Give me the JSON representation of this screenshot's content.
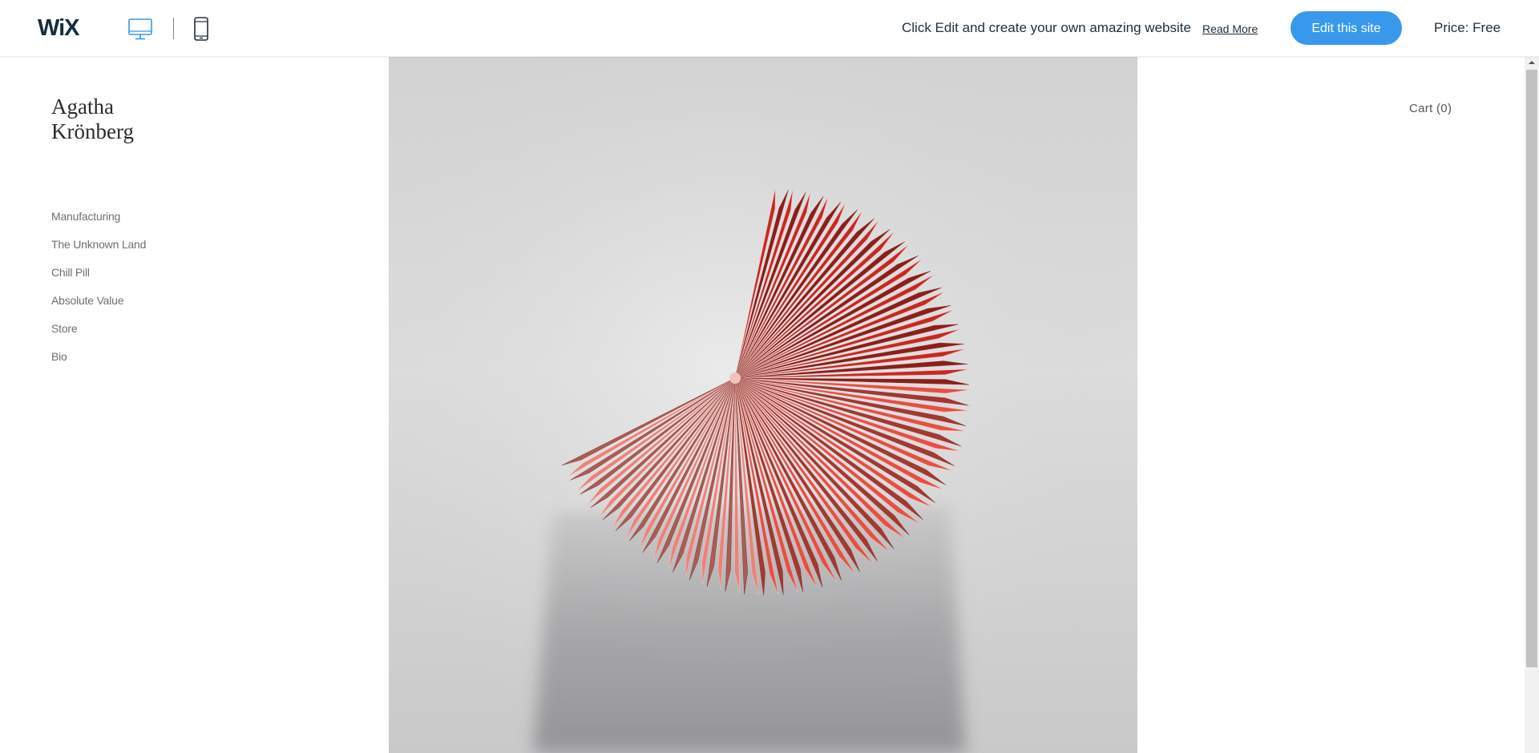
{
  "topbar": {
    "logo": "WiX",
    "promo_text": "Click Edit and create your own amazing website",
    "read_more": "Read More",
    "edit_button": "Edit this site",
    "price": "Price: Free",
    "active_device": "desktop"
  },
  "site": {
    "name_line1": "Agatha",
    "name_line2": "Krönberg",
    "nav": [
      {
        "label": "Manufacturing"
      },
      {
        "label": "The Unknown Land"
      },
      {
        "label": "Chill Pill"
      },
      {
        "label": "Absolute Value"
      },
      {
        "label": "Store"
      },
      {
        "label": "Bio"
      }
    ],
    "cart": "Cart (0)"
  },
  "icons": {
    "desktop": "desktop-monitor-icon",
    "mobile": "mobile-phone-icon"
  },
  "colors": {
    "accent": "#3899ec",
    "fan_red": "#e8473c",
    "wix_dark": "#162d3d"
  }
}
